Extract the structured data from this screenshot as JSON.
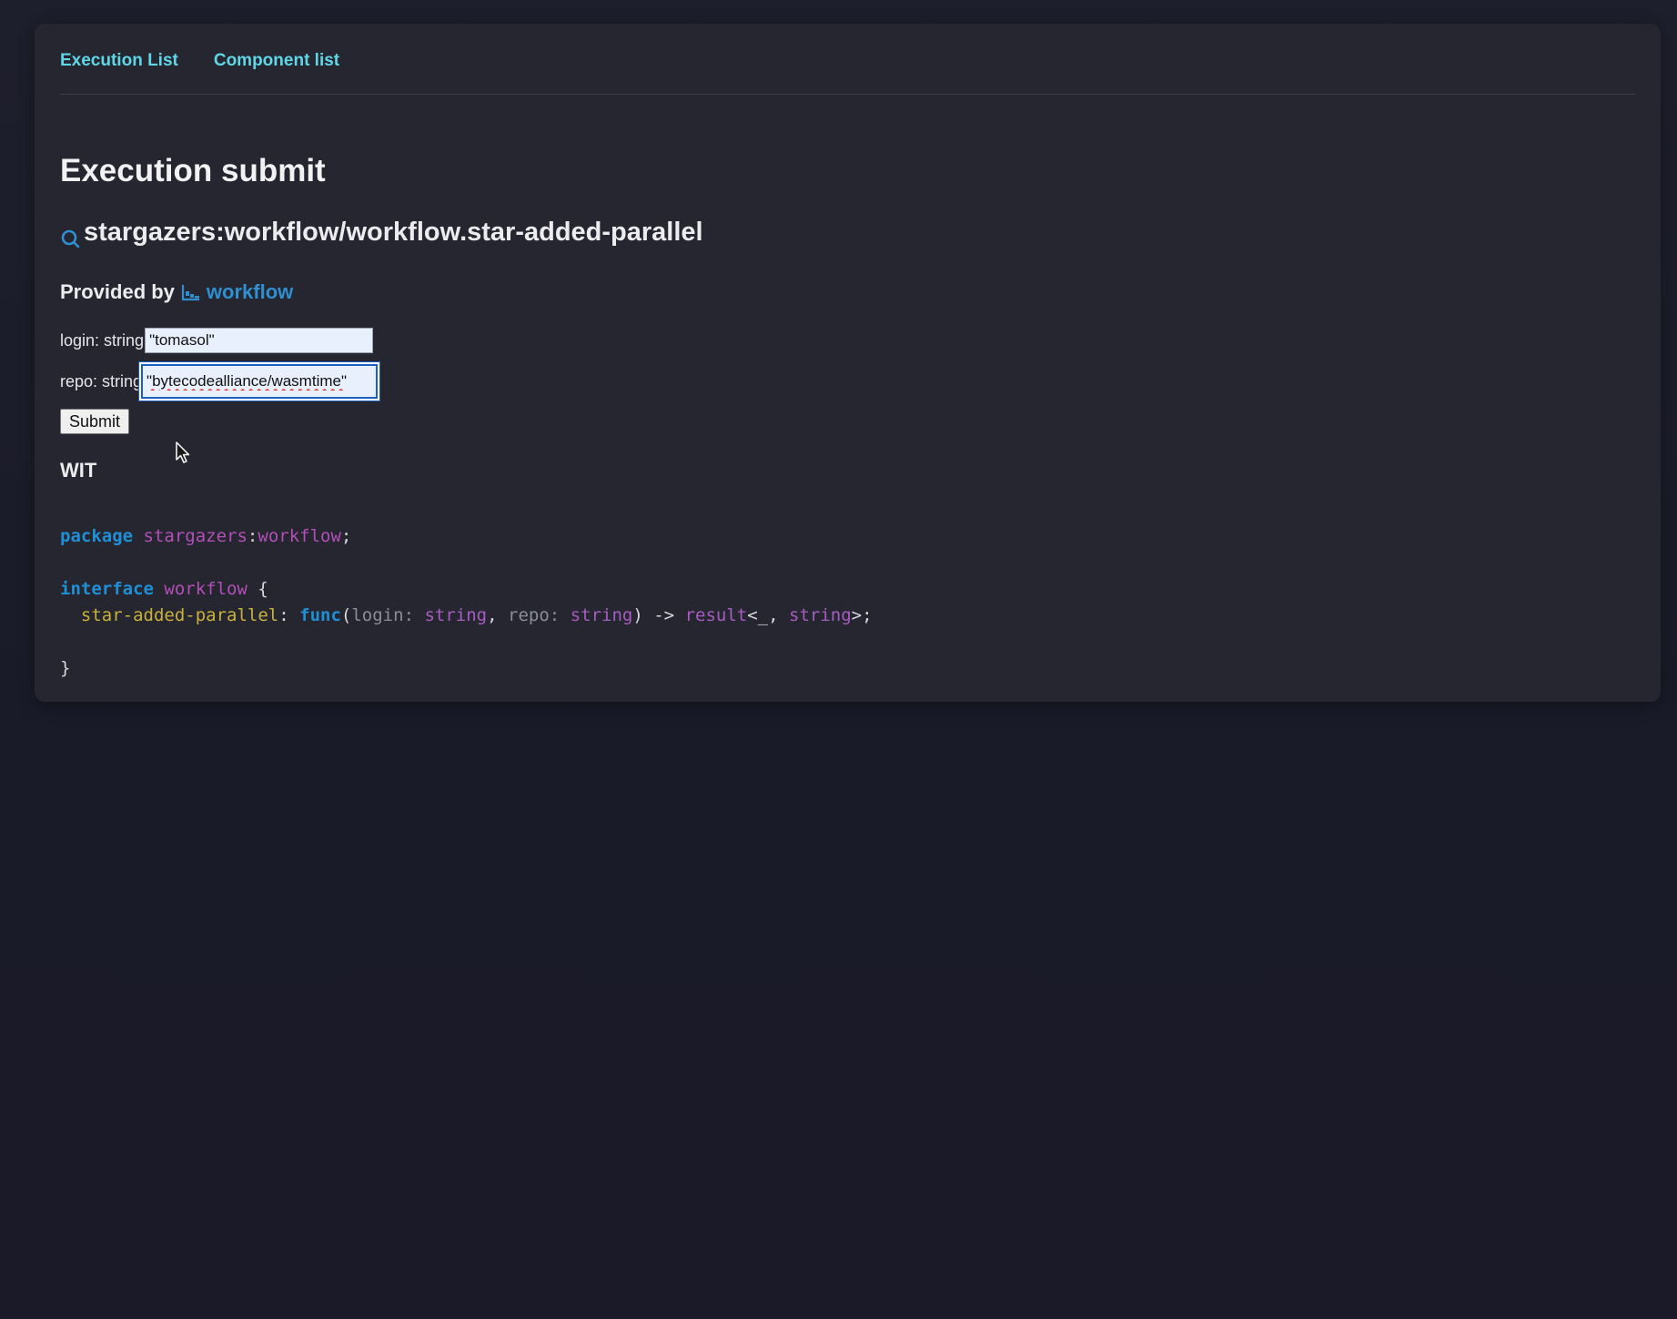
{
  "nav": {
    "execution_list": "Execution List",
    "component_list": "Component list"
  },
  "page": {
    "title": "Execution submit",
    "function_name": "stargazers:workflow/workflow.star-added-parallel",
    "provided_by_label": "Provided by",
    "component_name": "workflow"
  },
  "form": {
    "login_label": "login: string",
    "login_value": "\"tomasol\"",
    "repo_label": "repo: string",
    "repo_value": "\"bytecodealliance/wasmtime\"",
    "submit_label": "Submit"
  },
  "wit": {
    "heading": "WIT",
    "kw_package": "package",
    "pkg_ns": "stargazers",
    "pkg_colon": ":",
    "pkg_name": "workflow",
    "semi": ";",
    "kw_interface": "interface",
    "iface_name": "workflow",
    "open_brace": "{",
    "fn_name": "star-added-parallel",
    "colon": ":",
    "kw_func": "func",
    "paren_open": "(",
    "p1_name": "login",
    "p1_colon": ":",
    "p1_type": "string",
    "comma": ",",
    "p2_name": "repo",
    "p2_colon": ":",
    "p2_type": "string",
    "paren_close": ")",
    "arrow": "->",
    "ret_type": "result",
    "ret_open": "<_,",
    "ret_inner": "string",
    "ret_close": ">;",
    "close_brace": "}"
  },
  "colors": {
    "background": "#1b1b2b",
    "card": "#25262f",
    "nav_link": "#5fd7e6",
    "component_link": "#2f8fd0",
    "keyword": "#1f8fd6",
    "identifier": "#b24fb8",
    "function_name": "#c9b23a"
  },
  "icons": {
    "function": "search-magnifier-icon",
    "component": "component-stairs-icon",
    "mouse": "mouse-pointer-icon"
  }
}
